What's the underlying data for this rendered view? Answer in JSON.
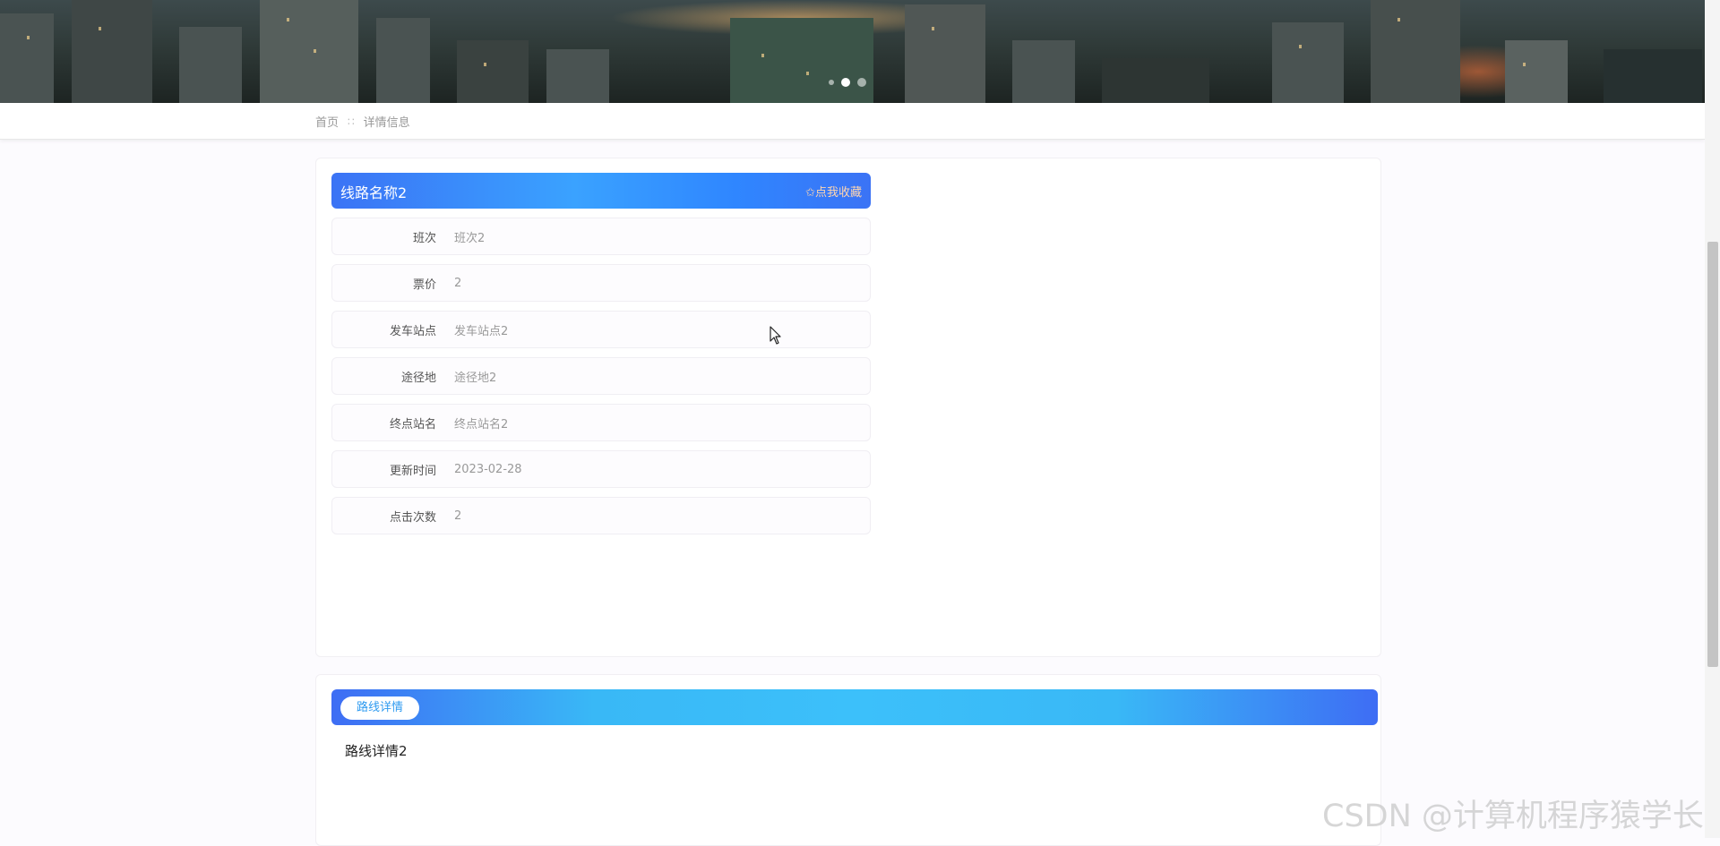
{
  "breadcrumb": {
    "home": "首页",
    "separator": "∷",
    "current": "详情信息"
  },
  "detail": {
    "title": "线路名称2",
    "favorite_label": "✩点我收藏",
    "fields": [
      {
        "label": "班次",
        "value": "班次2"
      },
      {
        "label": "票价",
        "value": "2"
      },
      {
        "label": "发车站点",
        "value": "发车站点2"
      },
      {
        "label": "途径地",
        "value": "途径地2"
      },
      {
        "label": "终点站名",
        "value": "终点站名2"
      },
      {
        "label": "更新时间",
        "value": "2023-02-28"
      },
      {
        "label": "点击次数",
        "value": "2"
      }
    ]
  },
  "route_details": {
    "tab_label": "路线详情",
    "content": "路线详情2"
  },
  "watermark": "CSDN @计算机程序猿学长",
  "colors": {
    "title_bar": "#3aa2ff",
    "route_bar": "#3cc0fa",
    "favorite_text": "#ffd6b0"
  }
}
